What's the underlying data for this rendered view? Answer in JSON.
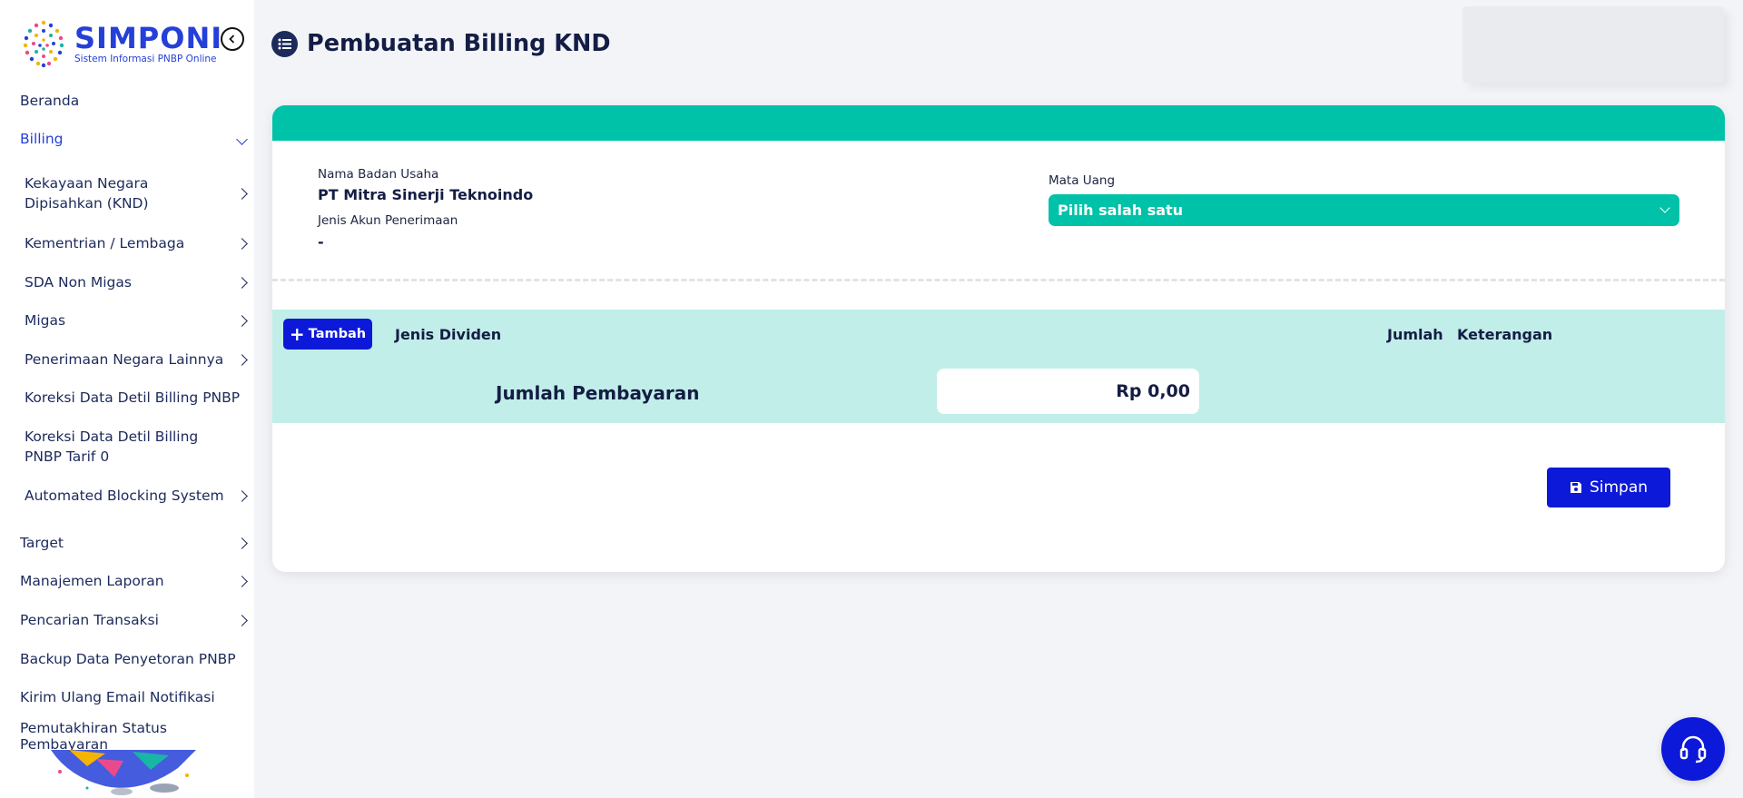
{
  "sidebar": {
    "logo": {
      "title": "SIMPONI",
      "subtitle": "Sistem Informasi PNBP Online"
    },
    "items": [
      {
        "label": "Beranda"
      },
      {
        "label": "Billing"
      },
      {
        "label": "Kekayaan Negara Dipisahkan (KND)"
      },
      {
        "label": "Kementrian / Lembaga"
      },
      {
        "label": "SDA Non Migas"
      },
      {
        "label": "Migas"
      },
      {
        "label": "Penerimaan Negara Lainnya"
      },
      {
        "label": "Koreksi Data Detil Billing PNBP"
      },
      {
        "label": "Koreksi Data Detil Billing PNBP Tarif 0"
      },
      {
        "label": "Automated Blocking System"
      },
      {
        "label": "Target"
      },
      {
        "label": "Manajemen Laporan"
      },
      {
        "label": "Pencarian Transaksi"
      },
      {
        "label": "Backup Data Penyetoran PNBP"
      },
      {
        "label": "Kirim Ulang Email Notifikasi"
      },
      {
        "label": "Pemutakhiran Status Pembayaran"
      }
    ]
  },
  "header": {
    "title": "Pembuatan Billing KND"
  },
  "form": {
    "company_label": "Nama Badan Usaha",
    "company_value": "PT Mitra Sinerji Teknoindo",
    "account_type_label": "Jenis Akun Penerimaan",
    "account_type_value": "-",
    "currency_label": "Mata Uang",
    "currency_selected": "Pilih salah satu"
  },
  "table": {
    "add_button": "Tambah",
    "columns": [
      "Jenis Dividen",
      "Jumlah",
      "Keterangan"
    ],
    "total_label": "Jumlah Pembayaran",
    "total_value": "Rp 0,00"
  },
  "actions": {
    "save_label": "Simpan"
  },
  "colors": {
    "teal": "#00c2a8",
    "light_teal": "#c1eee9",
    "primary": "#0d19d9",
    "brand": "#2540d8",
    "navy": "#141d44"
  },
  "icons": {
    "collapse": "chevron-left-circle-icon",
    "title": "list-icon",
    "save": "floppy-disk-icon",
    "help": "headset-icon"
  }
}
